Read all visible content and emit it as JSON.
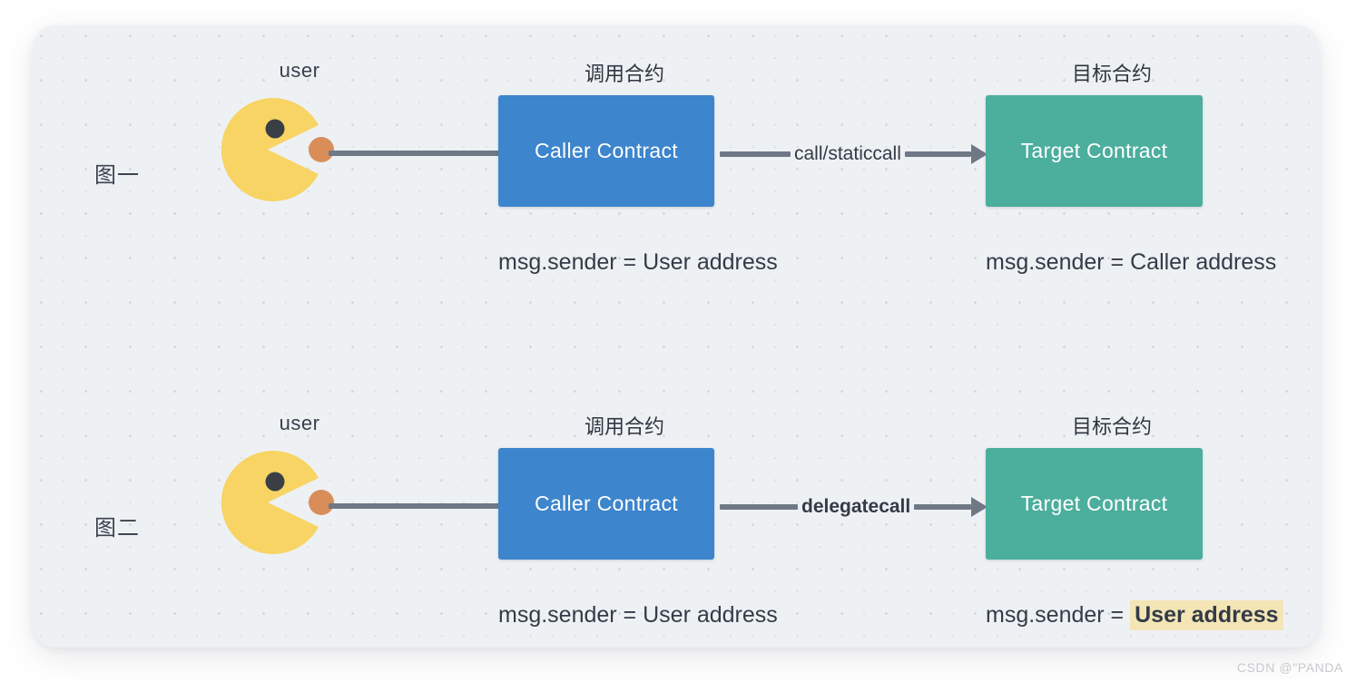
{
  "watermark": "CSDN @\"PANDA",
  "colors": {
    "card_bg": "#eef1f4",
    "caller_box": "#3d85cc",
    "target_box": "#4cae9c",
    "arrow": "#6f7885",
    "pacman": "#f7d464",
    "pacman_eye": "#3a3f46",
    "pacman_ball": "#d98e59",
    "highlight": "#f3e5b5",
    "text": "#343b47"
  },
  "figures": [
    {
      "row_label": "图一",
      "user_caption": "user",
      "caller_caption": "调用合约",
      "target_caption": "目标合约",
      "caller_box_label": "Caller Contract",
      "target_box_label": "Target Contract",
      "arrow_label": "call/staticcall",
      "arrow_label_bold": false,
      "caller_msg_prefix": "msg.sender = ",
      "caller_msg_value": "User address",
      "caller_msg_highlighted": false,
      "target_msg_prefix": "msg.sender = ",
      "target_msg_value": "Caller address",
      "target_msg_highlighted": false
    },
    {
      "row_label": "图二",
      "user_caption": "user",
      "caller_caption": "调用合约",
      "target_caption": "目标合约",
      "caller_box_label": "Caller Contract",
      "target_box_label": "Target Contract",
      "arrow_label": "delegatecall",
      "arrow_label_bold": true,
      "caller_msg_prefix": "msg.sender = ",
      "caller_msg_value": "User address",
      "caller_msg_highlighted": false,
      "target_msg_prefix": "msg.sender = ",
      "target_msg_value": "User address",
      "target_msg_highlighted": true
    }
  ]
}
